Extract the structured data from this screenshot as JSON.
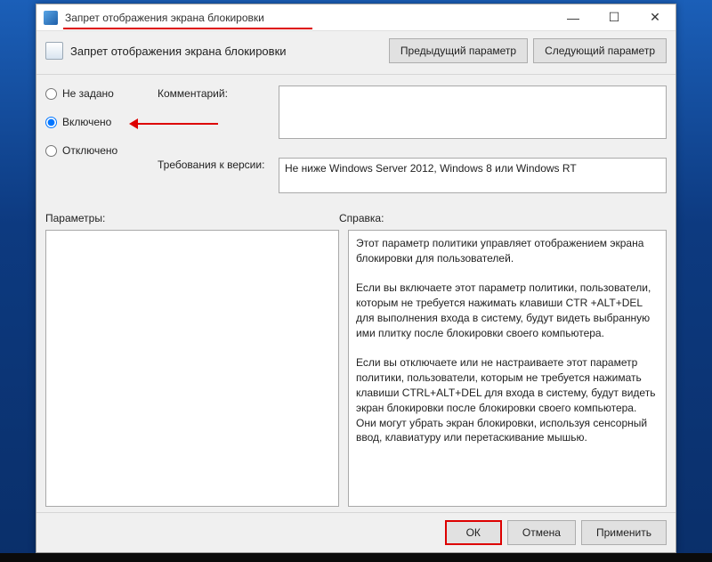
{
  "window": {
    "title": "Запрет отображения экрана блокировки",
    "min_tooltip": "Свернуть",
    "max_tooltip": "Развернуть",
    "close_tooltip": "Закрыть"
  },
  "header": {
    "title": "Запрет отображения экрана блокировки",
    "prev_button": "Предыдущий параметр",
    "next_button": "Следующий параметр"
  },
  "settings": {
    "not_configured": "Не задано",
    "enabled": "Включено",
    "disabled": "Отключено",
    "selected": "enabled"
  },
  "labels": {
    "comment": "Комментарий:",
    "requirements": "Требования к версии:",
    "options": "Параметры:",
    "help": "Справка:"
  },
  "fields": {
    "comment": "",
    "requirements": "Не ниже Windows Server 2012, Windows 8 или Windows RT",
    "options": "",
    "help_p1": "Этот параметр политики управляет отображением экрана блокировки для пользователей.",
    "help_p2": "Если вы включаете этот параметр политики, пользователи, которым не требуется нажимать клавиши CTR +ALT+DEL для выполнения входа в систему, будут видеть выбранную ими плитку после блокировки своего компьютера.",
    "help_p3": "Если вы отключаете или не настраиваете этот параметр политики, пользователи, которым не требуется нажимать клавиши CTRL+ALT+DEL для входа в систему, будут видеть экран блокировки после блокировки своего компьютера. Они могут убрать экран блокировки, используя сенсорный ввод, клавиатуру или перетаскивание мышью."
  },
  "footer": {
    "ok": "ОК",
    "cancel": "Отмена",
    "apply": "Применить"
  }
}
